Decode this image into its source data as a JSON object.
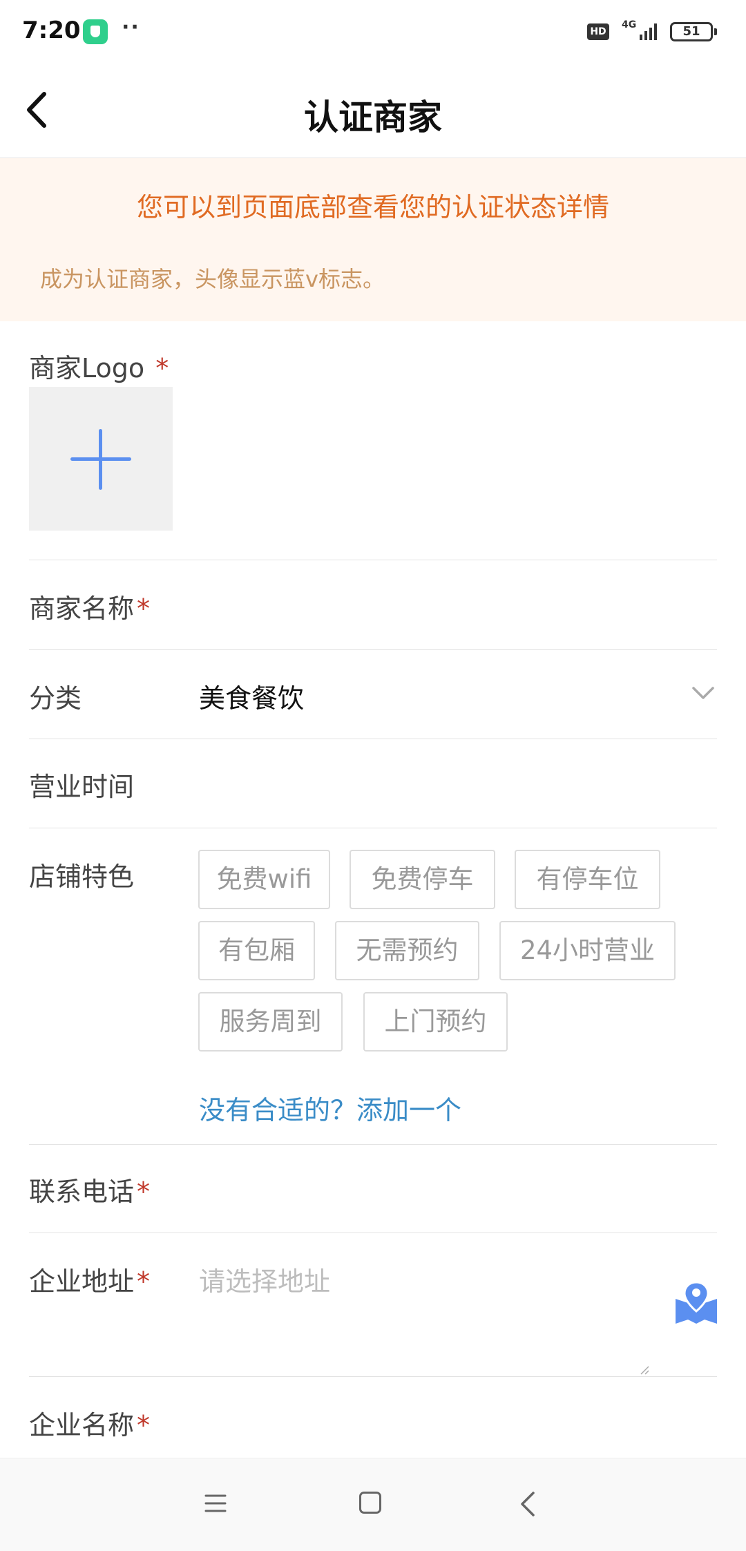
{
  "status_bar": {
    "time": "7:20",
    "dots": "··",
    "hd": "HD",
    "network": "4G",
    "battery": "51",
    "app_icon": "shield-check-icon"
  },
  "header": {
    "title": "认证商家",
    "back_icon": "chevron-left-icon"
  },
  "notice": {
    "main": "您可以到页面底部查看您的认证状态详情",
    "sub": "成为认证商家，头像显示蓝v标志。",
    "main_color": "#e06a22",
    "sub_color": "#c99561",
    "background": "#fff6ef"
  },
  "form": {
    "logo": {
      "label": "商家Logo",
      "required_mark": "*",
      "upload_icon": "plus-icon"
    },
    "name": {
      "label": "商家名称",
      "required_mark": "*"
    },
    "category": {
      "label": "分类",
      "value": "美食餐饮",
      "dropdown_icon": "chevron-down-icon"
    },
    "hours": {
      "label": "营业时间"
    },
    "features": {
      "label": "店铺特色",
      "tags": [
        "免费wifi",
        "免费停车",
        "有停车位",
        "有包厢",
        "无需预约",
        "24小时营业",
        "服务周到",
        "上门预约"
      ],
      "add_link": "没有合适的？添加一个"
    },
    "phone": {
      "label": "联系电话",
      "required_mark": "*"
    },
    "address": {
      "label": "企业地址",
      "required_mark": "*",
      "placeholder": "请选择地址",
      "map_icon": "map-pin-icon"
    },
    "company": {
      "label": "企业名称",
      "required_mark": "*"
    }
  },
  "colors": {
    "accent_blue": "#5b8ff0",
    "link_blue": "#3a8cc7",
    "required_red": "#c0392b"
  },
  "bottom_nav": {
    "menu_icon": "menu-icon",
    "home_icon": "home-square-icon",
    "back_icon": "back-triangle-icon"
  }
}
